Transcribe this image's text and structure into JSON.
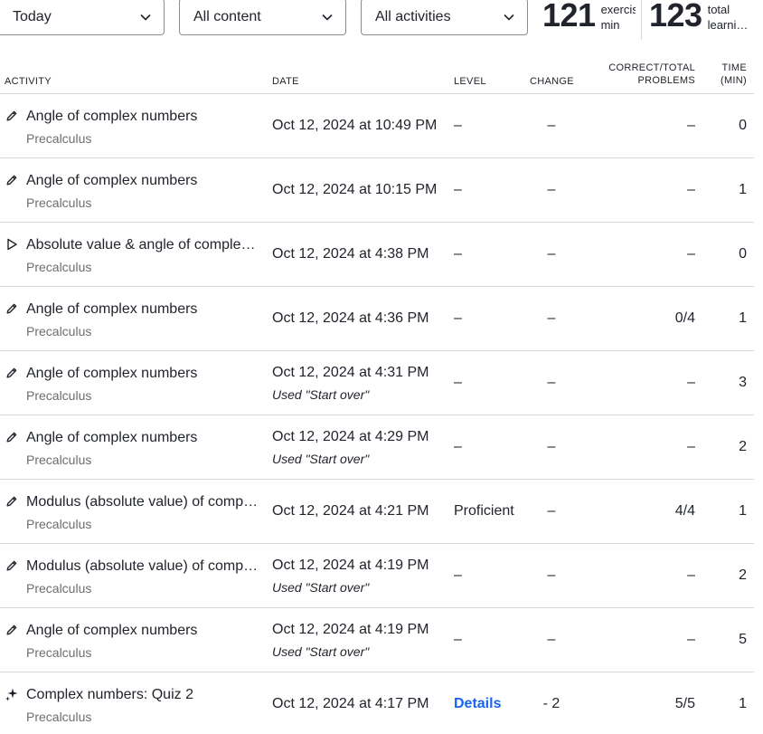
{
  "filters": {
    "date": "Today",
    "content": "All content",
    "activity": "All activities"
  },
  "stats": {
    "exercise_minutes": "121",
    "exercise_unit": "exercise\nmin",
    "total_minutes": "123",
    "total_unit": "total\nlearni…"
  },
  "table": {
    "headers": {
      "activity": "ACTIVITY",
      "date": "DATE",
      "level": "LEVEL",
      "change": "CHANGE",
      "correct_total_line1": "CORRECT/TOTAL",
      "correct_total_line2": "PROBLEMS",
      "time_line1": "TIME",
      "time_line2": "(MIN)"
    },
    "rows": [
      {
        "icon": "pencil-icon",
        "title": "Angle of complex numbers",
        "course": "Precalculus",
        "date": "Oct 12, 2024 at 10:49 PM",
        "note": "",
        "level": "–",
        "change": "–",
        "ctp": "–",
        "time": "0"
      },
      {
        "icon": "pencil-icon",
        "title": "Angle of complex numbers",
        "course": "Precalculus",
        "date": "Oct 12, 2024 at 10:15 PM",
        "note": "",
        "level": "–",
        "change": "–",
        "ctp": "–",
        "time": "1"
      },
      {
        "icon": "play-icon",
        "title": "Absolute value & angle of complex numbers",
        "course": "Precalculus",
        "date": "Oct 12, 2024 at 4:38 PM",
        "note": "",
        "level": "–",
        "change": "–",
        "ctp": "–",
        "time": "0"
      },
      {
        "icon": "pencil-icon",
        "title": "Angle of complex numbers",
        "course": "Precalculus",
        "date": "Oct 12, 2024 at 4:36 PM",
        "note": "",
        "level": "–",
        "change": "–",
        "ctp": "0/4",
        "time": "1"
      },
      {
        "icon": "pencil-icon",
        "title": "Angle of complex numbers",
        "course": "Precalculus",
        "date": "Oct 12, 2024 at 4:31 PM",
        "note": "Used \"Start over\"",
        "level": "–",
        "change": "–",
        "ctp": "–",
        "time": "3"
      },
      {
        "icon": "pencil-icon",
        "title": "Angle of complex numbers",
        "course": "Precalculus",
        "date": "Oct 12, 2024 at 4:29 PM",
        "note": "Used \"Start over\"",
        "level": "–",
        "change": "–",
        "ctp": "–",
        "time": "2"
      },
      {
        "icon": "pencil-icon",
        "title": "Modulus (absolute value) of complex numbers",
        "course": "Precalculus",
        "date": "Oct 12, 2024 at 4:21 PM",
        "note": "",
        "level": "Proficient",
        "change": "–",
        "ctp": "4/4",
        "time": "1"
      },
      {
        "icon": "pencil-icon",
        "title": "Modulus (absolute value) of complex numbers",
        "course": "Precalculus",
        "date": "Oct 12, 2024 at 4:19 PM",
        "note": "Used \"Start over\"",
        "level": "–",
        "change": "–",
        "ctp": "–",
        "time": "2"
      },
      {
        "icon": "pencil-icon",
        "title": "Angle of complex numbers",
        "course": "Precalculus",
        "date": "Oct 12, 2024 at 4:19 PM",
        "note": "Used \"Start over\"",
        "level": "–",
        "change": "–",
        "ctp": "–",
        "time": "5"
      },
      {
        "icon": "quiz-sparkle-icon",
        "title": "Complex numbers: Quiz 2",
        "course": "Precalculus",
        "date": "Oct 12, 2024 at 4:17 PM",
        "note": "",
        "level": "Details",
        "level_is_link": true,
        "change": "- 2",
        "ctp": "5/5",
        "time": "1"
      }
    ]
  },
  "colors": {
    "text": "#21242c",
    "subtext": "#6b6d70",
    "link": "#1865f2",
    "divider": "#d6d8da"
  }
}
